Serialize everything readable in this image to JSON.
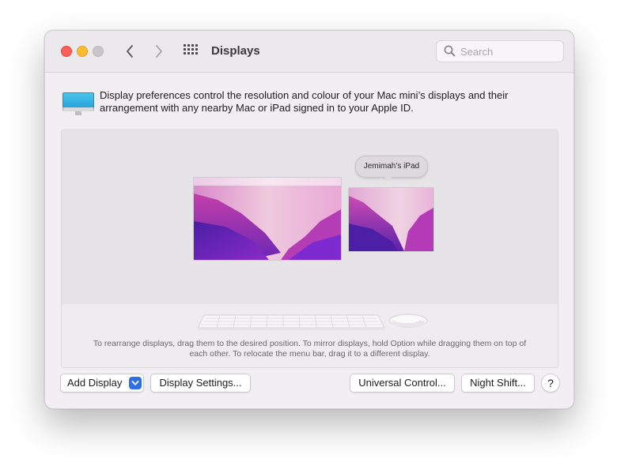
{
  "window": {
    "title": "Displays",
    "search_placeholder": "Search"
  },
  "info": {
    "text": "Display preferences control the resolution and colour of your Mac mini’s displays and their arrangement with any nearby Mac or iPad signed in to your Apple ID."
  },
  "arrangement": {
    "ipad_label": "Jemimah’s iPad",
    "hint": "To rearrange displays, drag them to the desired position. To mirror displays, hold Option while dragging them on top of each other. To relocate the menu bar, drag it to a different display."
  },
  "buttons": {
    "add_display": "Add Display",
    "display_settings": "Display Settings...",
    "universal_control": "Universal Control...",
    "night_shift": "Night Shift...",
    "help": "?"
  },
  "icons": {
    "traffic_lights": [
      "close-icon",
      "minimize-icon",
      "zoom-icon"
    ],
    "nav": [
      "chevron-left-icon",
      "chevron-right-icon",
      "grid-icon"
    ],
    "search": "search-icon",
    "display": "monitor-icon",
    "dropdown": "chevron-down-icon"
  },
  "colors": {
    "accent": "#2f6fe4",
    "close": "#fe5f57",
    "minimize": "#febc2e"
  }
}
